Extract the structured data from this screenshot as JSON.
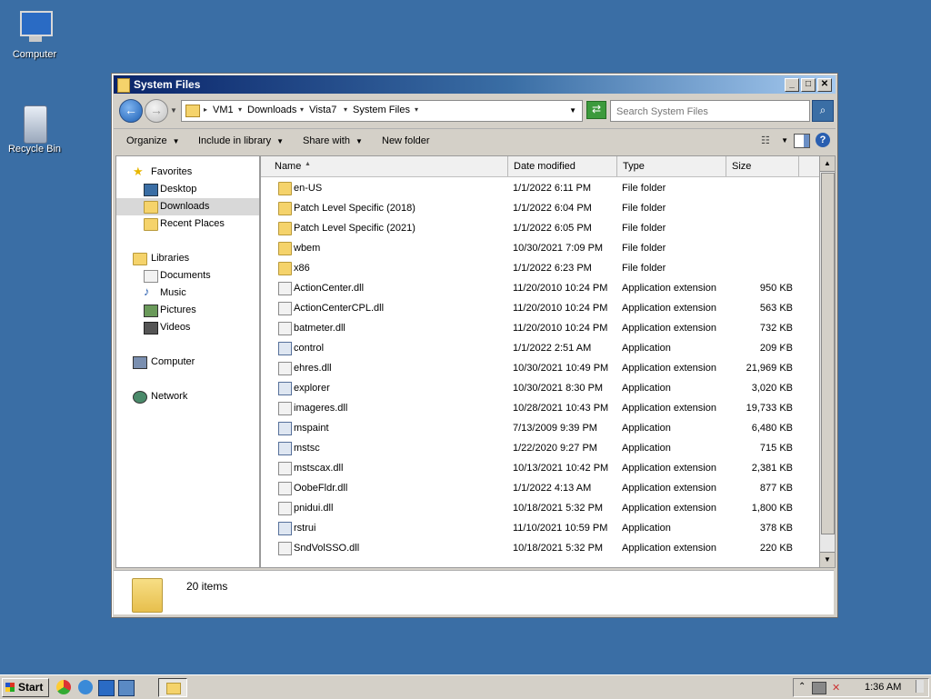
{
  "desktop": {
    "icons": [
      {
        "label": "Computer"
      },
      {
        "label": "Recycle Bin"
      }
    ]
  },
  "window": {
    "title": "System Files",
    "breadcrumb": [
      "VM1",
      "Downloads",
      "Vista7",
      "System Files"
    ],
    "search_placeholder": "Search System Files",
    "commands": {
      "organize": "Organize",
      "include_in_library": "Include in library",
      "share_with": "Share with",
      "new_folder": "New folder"
    }
  },
  "nav": {
    "favorites_header": "Favorites",
    "favorites": [
      "Desktop",
      "Downloads",
      "Recent Places"
    ],
    "selected": "Downloads",
    "libraries_header": "Libraries",
    "libraries": [
      "Documents",
      "Music",
      "Pictures",
      "Videos"
    ],
    "computer": "Computer",
    "network": "Network"
  },
  "columns": {
    "name": "Name",
    "date": "Date modified",
    "type": "Type",
    "size": "Size"
  },
  "files": [
    {
      "name": "en-US",
      "date": "1/1/2022 6:11 PM",
      "type": "File folder",
      "size": "",
      "icon": "folder-icon"
    },
    {
      "name": "Patch Level Specific (2018)",
      "date": "1/1/2022 6:04 PM",
      "type": "File folder",
      "size": "",
      "icon": "folder-icon"
    },
    {
      "name": "Patch Level Specific (2021)",
      "date": "1/1/2022 6:05 PM",
      "type": "File folder",
      "size": "",
      "icon": "folder-icon"
    },
    {
      "name": "wbem",
      "date": "10/30/2021 7:09 PM",
      "type": "File folder",
      "size": "",
      "icon": "folder-icon"
    },
    {
      "name": "x86",
      "date": "1/1/2022 6:23 PM",
      "type": "File folder",
      "size": "",
      "icon": "folder-icon"
    },
    {
      "name": "ActionCenter.dll",
      "date": "11/20/2010 10:24 PM",
      "type": "Application extension",
      "size": "950 KB",
      "icon": "dll-icon"
    },
    {
      "name": "ActionCenterCPL.dll",
      "date": "11/20/2010 10:24 PM",
      "type": "Application extension",
      "size": "563 KB",
      "icon": "dll-icon"
    },
    {
      "name": "batmeter.dll",
      "date": "11/20/2010 10:24 PM",
      "type": "Application extension",
      "size": "732 KB",
      "icon": "dll-icon"
    },
    {
      "name": "control",
      "date": "1/1/2022 2:51 AM",
      "type": "Application",
      "size": "209 KB",
      "icon": "app-icon"
    },
    {
      "name": "ehres.dll",
      "date": "10/30/2021 10:49 PM",
      "type": "Application extension",
      "size": "21,969 KB",
      "icon": "dll-icon"
    },
    {
      "name": "explorer",
      "date": "10/30/2021 8:30 PM",
      "type": "Application",
      "size": "3,020 KB",
      "icon": "app-icon"
    },
    {
      "name": "imageres.dll",
      "date": "10/28/2021 10:43 PM",
      "type": "Application extension",
      "size": "19,733 KB",
      "icon": "dll-icon"
    },
    {
      "name": "mspaint",
      "date": "7/13/2009 9:39 PM",
      "type": "Application",
      "size": "6,480 KB",
      "icon": "app-icon"
    },
    {
      "name": "mstsc",
      "date": "1/22/2020 9:27 PM",
      "type": "Application",
      "size": "715 KB",
      "icon": "app-icon"
    },
    {
      "name": "mstscax.dll",
      "date": "10/13/2021 10:42 PM",
      "type": "Application extension",
      "size": "2,381 KB",
      "icon": "dll-icon"
    },
    {
      "name": "OobeFldr.dll",
      "date": "1/1/2022 4:13 AM",
      "type": "Application extension",
      "size": "877 KB",
      "icon": "dll-icon"
    },
    {
      "name": "pnidui.dll",
      "date": "10/18/2021 5:32 PM",
      "type": "Application extension",
      "size": "1,800 KB",
      "icon": "dll-icon"
    },
    {
      "name": "rstrui",
      "date": "11/10/2021 10:59 PM",
      "type": "Application",
      "size": "378 KB",
      "icon": "app-icon"
    },
    {
      "name": "SndVolSSO.dll",
      "date": "10/18/2021 5:32 PM",
      "type": "Application extension",
      "size": "220 KB",
      "icon": "dll-icon"
    }
  ],
  "details": {
    "item_count": "20 items"
  },
  "taskbar": {
    "start_label": "Start",
    "clock": "1:36 AM"
  }
}
